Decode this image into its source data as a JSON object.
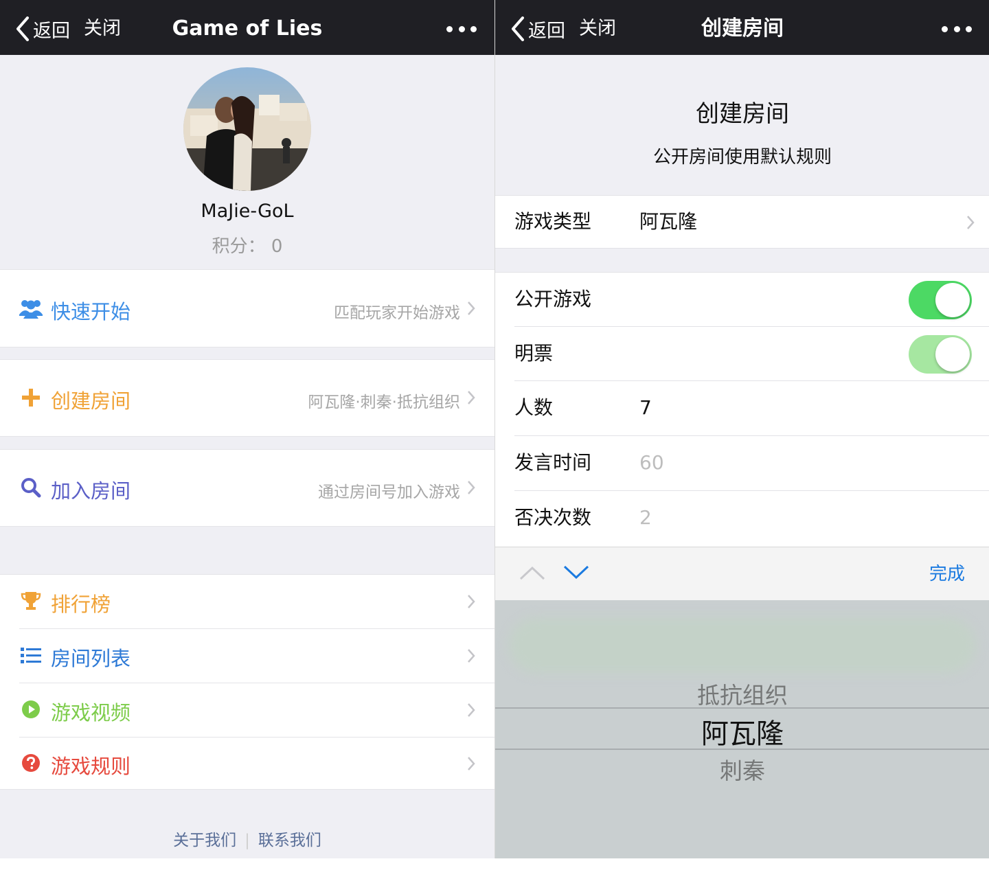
{
  "left": {
    "nav": {
      "back_label": "返回",
      "close_label": "关闭",
      "title": "Game of Lies"
    },
    "profile": {
      "username": "MaJie-GoL",
      "score": "积分： 0"
    },
    "menu": [
      {
        "label": "快速开始",
        "hint": "匹配玩家开始游戏",
        "icon": "users-icon",
        "color": "#3d8ee6"
      },
      {
        "label": "创建房间",
        "hint": "阿瓦隆·刺秦·抵抗组织",
        "icon": "plus-icon",
        "color": "#f0a236"
      },
      {
        "label": "加入房间",
        "hint": "通过房间号加入游戏",
        "icon": "search-icon",
        "color": "#5b5fc7"
      }
    ],
    "links": [
      {
        "label": "排行榜",
        "icon": "trophy-icon",
        "color": "#f0a236"
      },
      {
        "label": "房间列表",
        "icon": "list-icon",
        "color": "#2e7ad6"
      },
      {
        "label": "游戏视频",
        "icon": "play-icon",
        "color": "#7dcc4a"
      },
      {
        "label": "游戏规则",
        "icon": "help-icon",
        "color": "#e64a3e"
      }
    ],
    "footer": {
      "about": "关于我们",
      "contact": "联系我们"
    }
  },
  "right": {
    "nav": {
      "back_label": "返回",
      "close_label": "关闭",
      "title": "创建房间"
    },
    "header": {
      "title": "创建房间",
      "subtitle": "公开房间使用默认规则"
    },
    "game_type": {
      "label": "游戏类型",
      "value": "阿瓦隆"
    },
    "public_game": {
      "label": "公开游戏",
      "on": true,
      "color": "#4cd964"
    },
    "open_vote": {
      "label": "明票",
      "on": true,
      "color": "#a6e7a1"
    },
    "players": {
      "label": "人数",
      "value": "7"
    },
    "speak_time": {
      "label": "发言时间",
      "placeholder": "60"
    },
    "veto_count": {
      "label": "否决次数",
      "placeholder": "2"
    },
    "toolbar": {
      "done_label": "完成"
    },
    "picker": {
      "options": [
        "抵抗组织",
        "阿瓦隆",
        "刺秦"
      ],
      "selected": "阿瓦隆"
    }
  }
}
